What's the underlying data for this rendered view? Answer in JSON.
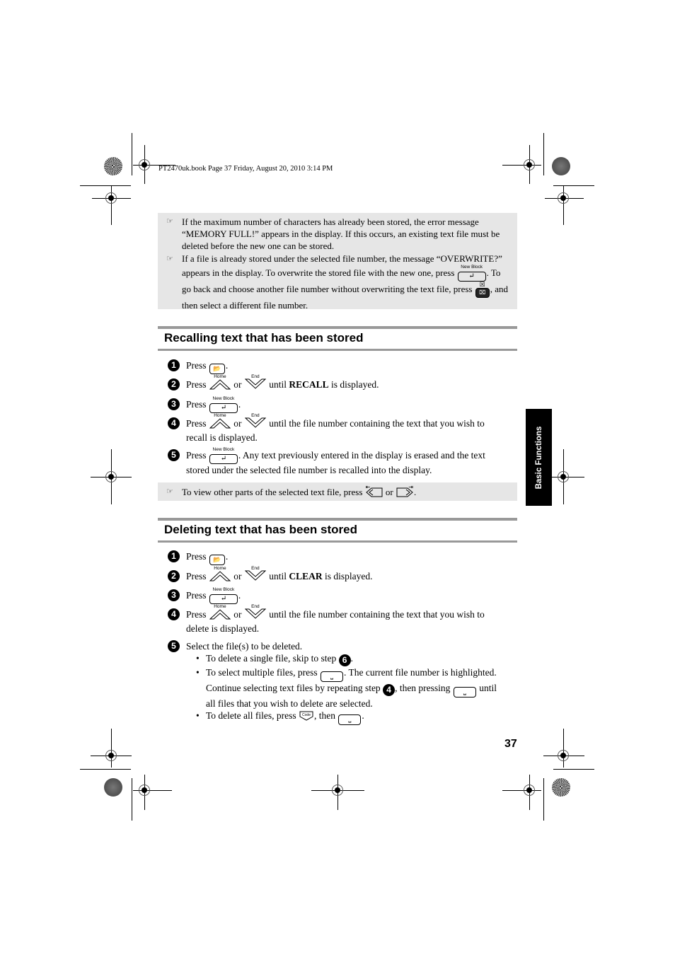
{
  "header": {
    "print_info": "PT2470uk.book  Page 37  Friday, August 20, 2010  3:14 PM"
  },
  "top_notes": [
    {
      "icon": "pointing-hand-icon",
      "text": "If the maximum number of characters has already been stored, the error message “MEMORY FULL!” appears in the display. If this occurs, an existing text file must be deleted before the new one can be stored."
    },
    {
      "icon": "pointing-hand-icon",
      "text_parts": [
        "If a file is already stored under the selected file number, the message “OVERWRITE?” appears in the display. To overwrite the stored file with the new one, press ",
        ". To go back and choose another file number without overwriting the text file, press ",
        ", and then select a different file number."
      ]
    }
  ],
  "keys": {
    "new_block_label": "New Block",
    "home_label": "Home",
    "end_label": "End",
    "code_label": "Code",
    "enter_glyph": "↵",
    "space_glyph": "⎵",
    "file_glyph": "📂",
    "esc_glyph": "⌧"
  },
  "recall_section": {
    "title": "Recalling text that has been stored",
    "steps": [
      {
        "num": "1",
        "text_parts": [
          "Press ",
          "."
        ]
      },
      {
        "num": "2",
        "text_parts": [
          "Press ",
          " or ",
          " until ",
          "RECALL",
          " is displayed."
        ]
      },
      {
        "num": "3",
        "text_parts": [
          "Press ",
          "."
        ]
      },
      {
        "num": "4",
        "text_parts": [
          "Press ",
          " or ",
          " until the file number containing the text that you wish to recall is displayed."
        ]
      },
      {
        "num": "5",
        "text_parts": [
          "Press ",
          ". Any text previously entered in the display is erased and the text stored under the selected file number is recalled into the display."
        ]
      }
    ],
    "note": {
      "icon": "pointing-hand-icon",
      "text_parts": [
        "To view other parts of the selected text file, press ",
        " or ",
        "."
      ]
    }
  },
  "delete_section": {
    "title": "Deleting text that has been stored",
    "steps": [
      {
        "num": "1",
        "text_parts": [
          "Press ",
          "."
        ]
      },
      {
        "num": "2",
        "text_parts": [
          "Press ",
          " or ",
          " until ",
          "CLEAR",
          " is displayed."
        ]
      },
      {
        "num": "3",
        "text_parts": [
          "Press ",
          "."
        ]
      },
      {
        "num": "4",
        "text_parts": [
          "Press ",
          " or ",
          " until the file number containing the text that you wish to delete is displayed."
        ]
      },
      {
        "num": "5",
        "text": "Select the file(s) to be deleted.",
        "bullets": [
          {
            "text_parts": [
              "To delete a single file, skip to step ",
              "6",
              "."
            ]
          },
          {
            "text_parts": [
              "To select multiple files, press ",
              ". The current file number is highlighted. Continue selecting text files by repeating step ",
              "4",
              ", then pressing ",
              " until all files that you wish to delete are selected."
            ]
          },
          {
            "text_parts": [
              "To delete all files, press ",
              ", then ",
              "."
            ]
          }
        ]
      }
    ]
  },
  "side_tab": {
    "label": "Basic Functions"
  },
  "footer": {
    "page_number": "37"
  }
}
